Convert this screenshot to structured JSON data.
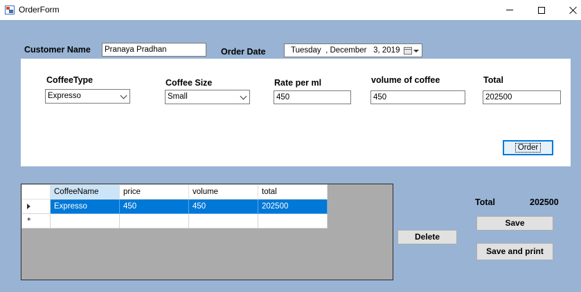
{
  "window": {
    "title": "OrderForm",
    "minimize_icon": "minimize-icon",
    "maximize_icon": "maximize-icon",
    "close_icon": "close-icon"
  },
  "header": {
    "customer_name_label": "Customer Name",
    "customer_name_value": "Pranaya Pradhan",
    "order_date_label": "Order Date",
    "order_date_value": "Tuesday  , December   3, 2019"
  },
  "order_panel": {
    "coffee_type_label": "CoffeeType",
    "coffee_type_value": "Expresso",
    "coffee_size_label": "Coffee Size",
    "coffee_size_value": "Small",
    "rate_label": "Rate per ml",
    "rate_value": "450",
    "volume_label": "volume of coffee",
    "volume_value": "450",
    "total_label": "Total",
    "total_value": "202500",
    "order_button": "Order"
  },
  "grid": {
    "columns": [
      "CoffeeName",
      "price",
      "volume",
      "total"
    ],
    "rows": [
      [
        "Expresso",
        "450",
        "450",
        "202500"
      ]
    ],
    "new_row_marker": "*"
  },
  "summary": {
    "total_label": "Total",
    "total_value": "202500",
    "delete_button": "Delete",
    "save_button": "Save",
    "save_print_button": "Save and print"
  },
  "colors": {
    "client_background": "#98b3d4",
    "selection": "#0078d7",
    "header_selected": "#cce4f7",
    "grid_background": "#ababab"
  }
}
